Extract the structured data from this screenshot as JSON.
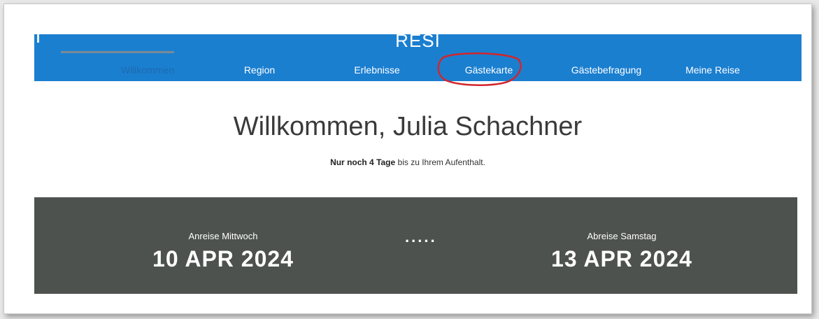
{
  "brand": "RESI",
  "nav": {
    "items": [
      {
        "label": "Willkommen",
        "active": true
      },
      {
        "label": "Region"
      },
      {
        "label": "Erlebnisse"
      },
      {
        "label": "Gästekarte",
        "highlighted": true
      },
      {
        "label": "Gästebefragung"
      },
      {
        "label": "Meine Reise"
      }
    ]
  },
  "welcome": {
    "title": "Willkommen, Julia Schachner",
    "countdown_bold": "Nur noch 4 Tage",
    "countdown_rest": "bis zu Ihrem Aufenthalt."
  },
  "stay": {
    "arrival_label": "Anreise Mittwoch",
    "arrival_date": "10 APR 2024",
    "separator": ".....",
    "departure_label": "Abreise Samstag",
    "departure_date": "13 APR 2024"
  },
  "colors": {
    "nav_bg": "#1b7fd0",
    "stay_bg": "#4d524f",
    "annotation": "#d2262c"
  }
}
